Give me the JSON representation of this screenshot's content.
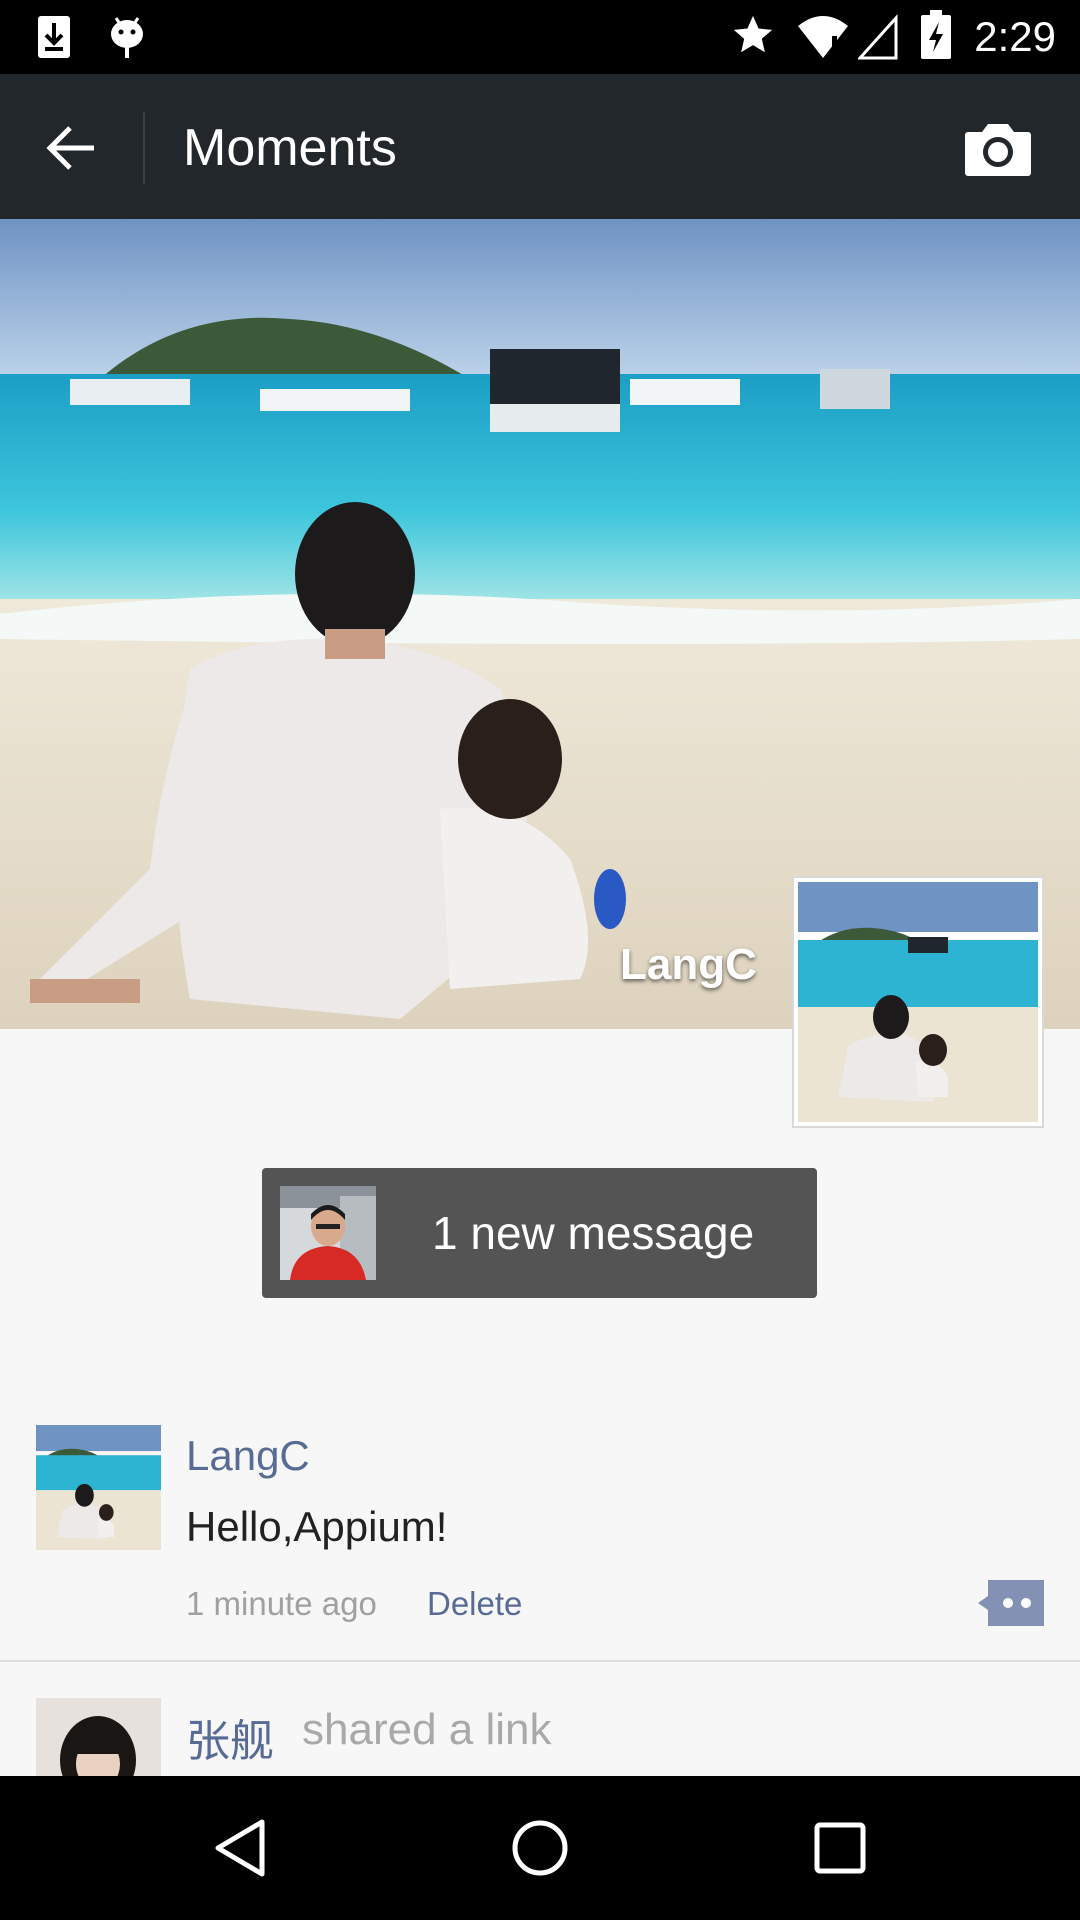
{
  "status_bar": {
    "time": "2:29",
    "icons": [
      "download-icon",
      "android-debug-icon",
      "star-icon",
      "wifi-icon",
      "signal-icon",
      "battery-charging-icon"
    ]
  },
  "action_bar": {
    "title": "Moments",
    "back_icon": "arrow-left-icon",
    "camera_icon": "camera-icon"
  },
  "cover": {
    "username": "LangC"
  },
  "new_message": {
    "label": "1 new message"
  },
  "feed": [
    {
      "author": "LangC",
      "text": "Hello,Appium!",
      "time": "1 minute ago",
      "delete_label": "Delete"
    },
    {
      "author": "张舰",
      "subtitle": "shared a link"
    }
  ],
  "nav_bar": {
    "icons": [
      "back-triangle-icon",
      "home-circle-icon",
      "recents-square-icon"
    ]
  },
  "colors": {
    "action_bar": "#22272b",
    "link_blue": "#576b95",
    "toast_bg": "#545454"
  }
}
